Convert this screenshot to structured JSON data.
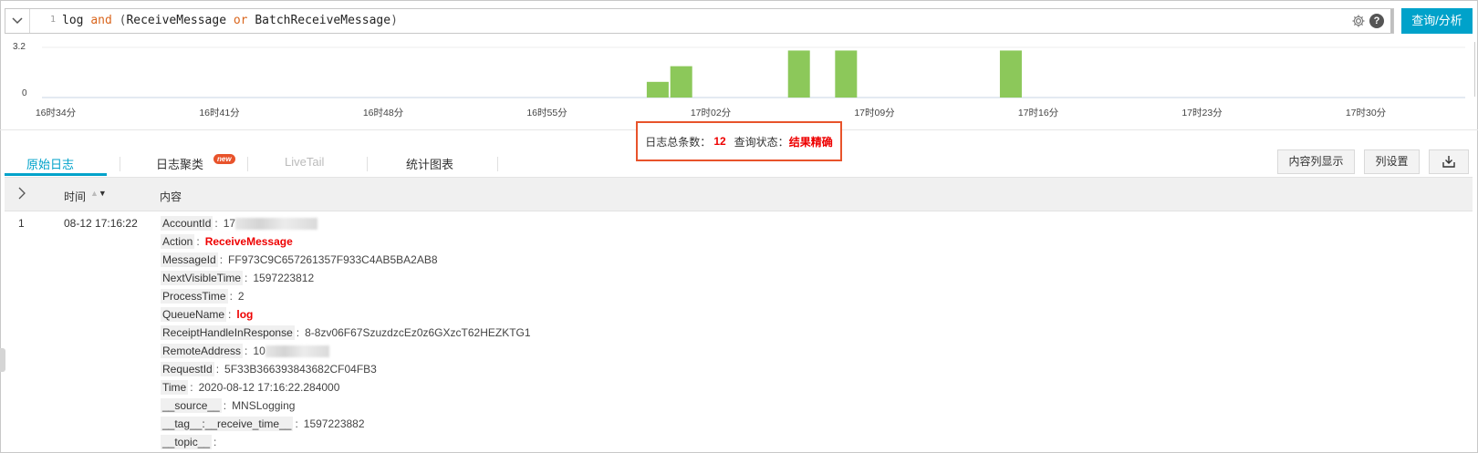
{
  "query": {
    "line_number": "1",
    "tokens": [
      {
        "text": "log ",
        "kind": "plain"
      },
      {
        "text": "and",
        "kind": "kw"
      },
      {
        "text": " (",
        "kind": "br"
      },
      {
        "text": "ReceiveMessage ",
        "kind": "plain"
      },
      {
        "text": "or",
        "kind": "kw"
      },
      {
        "text": " BatchReceiveMessage",
        "kind": "plain"
      },
      {
        "text": ")",
        "kind": "br"
      }
    ],
    "help_glyph": "?",
    "search_label": "查询/分析"
  },
  "histogram": {
    "y_ticks": [
      "3.2",
      "0"
    ],
    "x_ticks": [
      "16时34分",
      "16时41分",
      "16时48分",
      "16时55分",
      "17时02分",
      "17时09分",
      "17时16分",
      "17时23分",
      "17时30分"
    ],
    "bar_color": "#8cc85a",
    "bars": [
      {
        "time": "17时00分",
        "count": 1
      },
      {
        "time": "17时01分",
        "count": 2
      },
      {
        "time": "17时06分",
        "count": 3
      },
      {
        "time": "17时08分",
        "count": 3
      },
      {
        "time": "17时15分",
        "count": 3
      }
    ]
  },
  "status": {
    "total_label": "日志总条数：",
    "total_count": "12",
    "state_label": "查询状态：",
    "state_value": "结果精确"
  },
  "tabs": [
    {
      "label": "原始日志",
      "state": "active"
    },
    {
      "label": "日志聚类",
      "state": "normal",
      "badge": "new"
    },
    {
      "label": "LiveTail",
      "state": "disabled"
    },
    {
      "label": "统计图表",
      "state": "normal"
    }
  ],
  "actions": {
    "content_display": "内容列显示",
    "column_settings": "列设置"
  },
  "table": {
    "col_time": "时间",
    "col_content": "内容",
    "rows": [
      {
        "index": "1",
        "time": "08-12 17:16:22",
        "fields": [
          {
            "key": "AccountId",
            "value": "17",
            "masked": true
          },
          {
            "key": "Action",
            "value": "ReceiveMessage",
            "highlight": true
          },
          {
            "key": "MessageId",
            "value": "FF973C9C657261357F933C4AB5BA2AB8"
          },
          {
            "key": "NextVisibleTime",
            "value": "1597223812"
          },
          {
            "key": "ProcessTime",
            "value": "2"
          },
          {
            "key": "QueueName",
            "value": "log",
            "highlight": true
          },
          {
            "key": "ReceiptHandleInResponse",
            "value": "8-8zv06F67SzuzdzcEz0z6GXzcT62HEZKTG1"
          },
          {
            "key": "RemoteAddress",
            "value": "10",
            "masked": true
          },
          {
            "key": "RequestId",
            "value": "5F33B366393843682CF04FB3"
          },
          {
            "key": "Time",
            "value": "2020-08-12 17:16:22.284000"
          },
          {
            "key": "__source__",
            "value": "MNSLogging"
          },
          {
            "key": "__tag__:__receive_time__",
            "value": "1597223882"
          },
          {
            "key": "__topic__",
            "value": ""
          }
        ]
      }
    ]
  }
}
